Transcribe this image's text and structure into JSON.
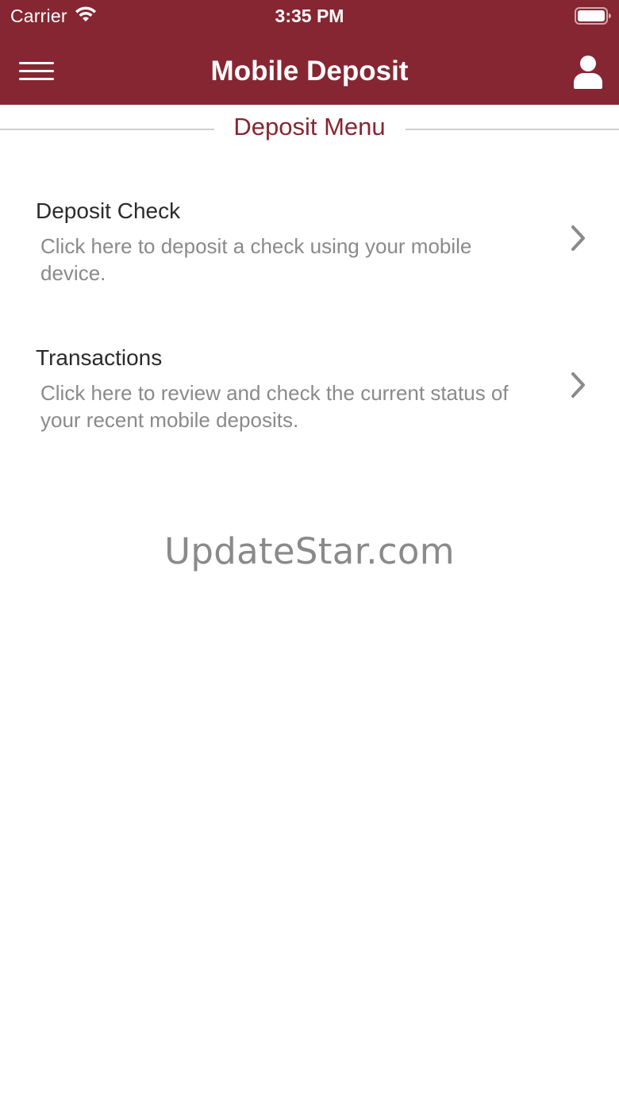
{
  "status_bar": {
    "carrier": "Carrier",
    "time": "3:35 PM",
    "icons": [
      "wifi-icon",
      "battery-icon"
    ]
  },
  "nav": {
    "title": "Mobile Deposit",
    "left_icon": "hamburger-menu-icon",
    "right_icon": "user-profile-icon"
  },
  "section": {
    "title": "Deposit Menu"
  },
  "menu": {
    "items": [
      {
        "title": "Deposit Check",
        "description": "Click here to deposit a check using your mobile device.",
        "icon": "chevron-right-icon"
      },
      {
        "title": "Transactions",
        "description": "Click here to review and check the current status of your recent mobile deposits.",
        "icon": "chevron-right-icon"
      }
    ]
  },
  "watermark": "UpdateStar.com",
  "colors": {
    "brand": "#862632",
    "title_text": "#2b2b2b",
    "secondary_text": "#8a8a8a",
    "divider": "#cfcfcf",
    "background": "#ffffff"
  }
}
